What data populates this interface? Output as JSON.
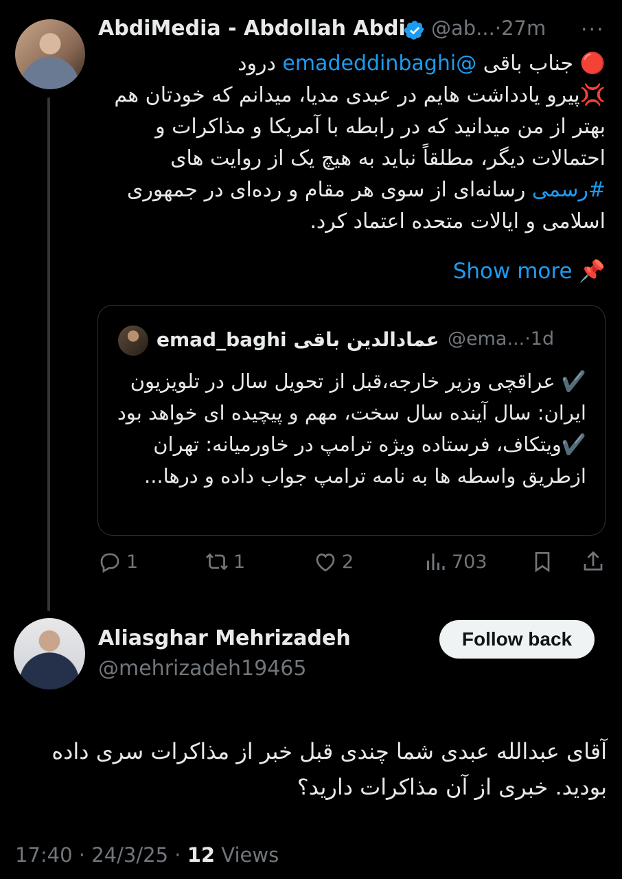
{
  "tweet": {
    "author_name": "AbdiMedia - Abdollah Abdi",
    "handle": "@ab...",
    "dot": "·",
    "time": "27m",
    "more_icon": "more-dots-icon",
    "line1_emoji": "🔴",
    "line1_a": " جناب باقی ",
    "line1_mention": "@emadeddinbaghi",
    "line1_b": " درود",
    "line2_emoji": "💢",
    "body_mid": "پیرو یادداشت هایم در عبدی مدیا، میدانم که خودتان هم بهتر از من میدانید که در رابطه با آمریکا و مذاکرات و احتمالات دیگر، مطلقاً نباید به هیچ یک از روایت های ",
    "hashtag": "#رسمی",
    "body_end": " رسانه‌ای از سوی هر مقام و رده‌ای در جمهوری اسلامی و ایالات متحده اعتماد کرد.",
    "show_more": "Show more",
    "pin_emoji": "📌"
  },
  "quote": {
    "name": "emad_baghi عمادالدین باقی",
    "handle": "@ema...",
    "time": "·1d",
    "text_line1": "✔️ عراقچی وزیر خارجه،قبل از تحویل سال در تلویزیون ایران: سال آینده سال سخت، مهم و پیچیده ای خواهد بود",
    "text_line2": "✔️ویتکاف، فرستاده ویژه ترامپ در خاورمیانه: تهران ازطریق واسطه ها به نامه ترامپ جواب داده و درها..."
  },
  "actions": {
    "replies": "1",
    "reposts": "1",
    "likes": "2",
    "views": "703"
  },
  "reply": {
    "author_name": "Aliasghar Mehrizadeh",
    "handle": "@mehrizadeh19465",
    "follow_label": "Follow back",
    "text": "آقای عبدالله عبدی شما چندی قبل خبر از مذاکرات سری داده بودید. خبری از آن مذاکرات دارید؟",
    "timestamp": "17:40 · 24/3/25 · ",
    "views_count": "12",
    "views_label": " Views"
  },
  "colors": {
    "accent": "#1d9bf0",
    "muted": "#71767b",
    "text": "#e7e9ea",
    "bg": "#000000"
  }
}
